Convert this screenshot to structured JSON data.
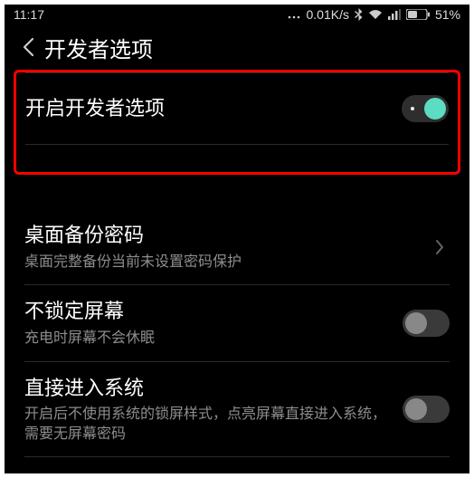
{
  "statusbar": {
    "time": "11:17",
    "network_text": "0.01K/s",
    "battery_text": "51%"
  },
  "header": {
    "title": "开发者选项"
  },
  "main_toggle": {
    "label": "开启开发者选项",
    "enabled": true
  },
  "rows": [
    {
      "title": "桌面备份密码",
      "subtitle": "桌面完整备份当前未设置密码保护",
      "type": "chevron"
    },
    {
      "title": "不锁定屏幕",
      "subtitle": "充电时屏幕不会休眠",
      "type": "toggle",
      "enabled": false
    },
    {
      "title": "直接进入系统",
      "subtitle": "开启后不使用系统的锁屏样式，点亮屏幕直接进入系统，需要无屏幕密码",
      "type": "toggle",
      "enabled": false
    }
  ]
}
